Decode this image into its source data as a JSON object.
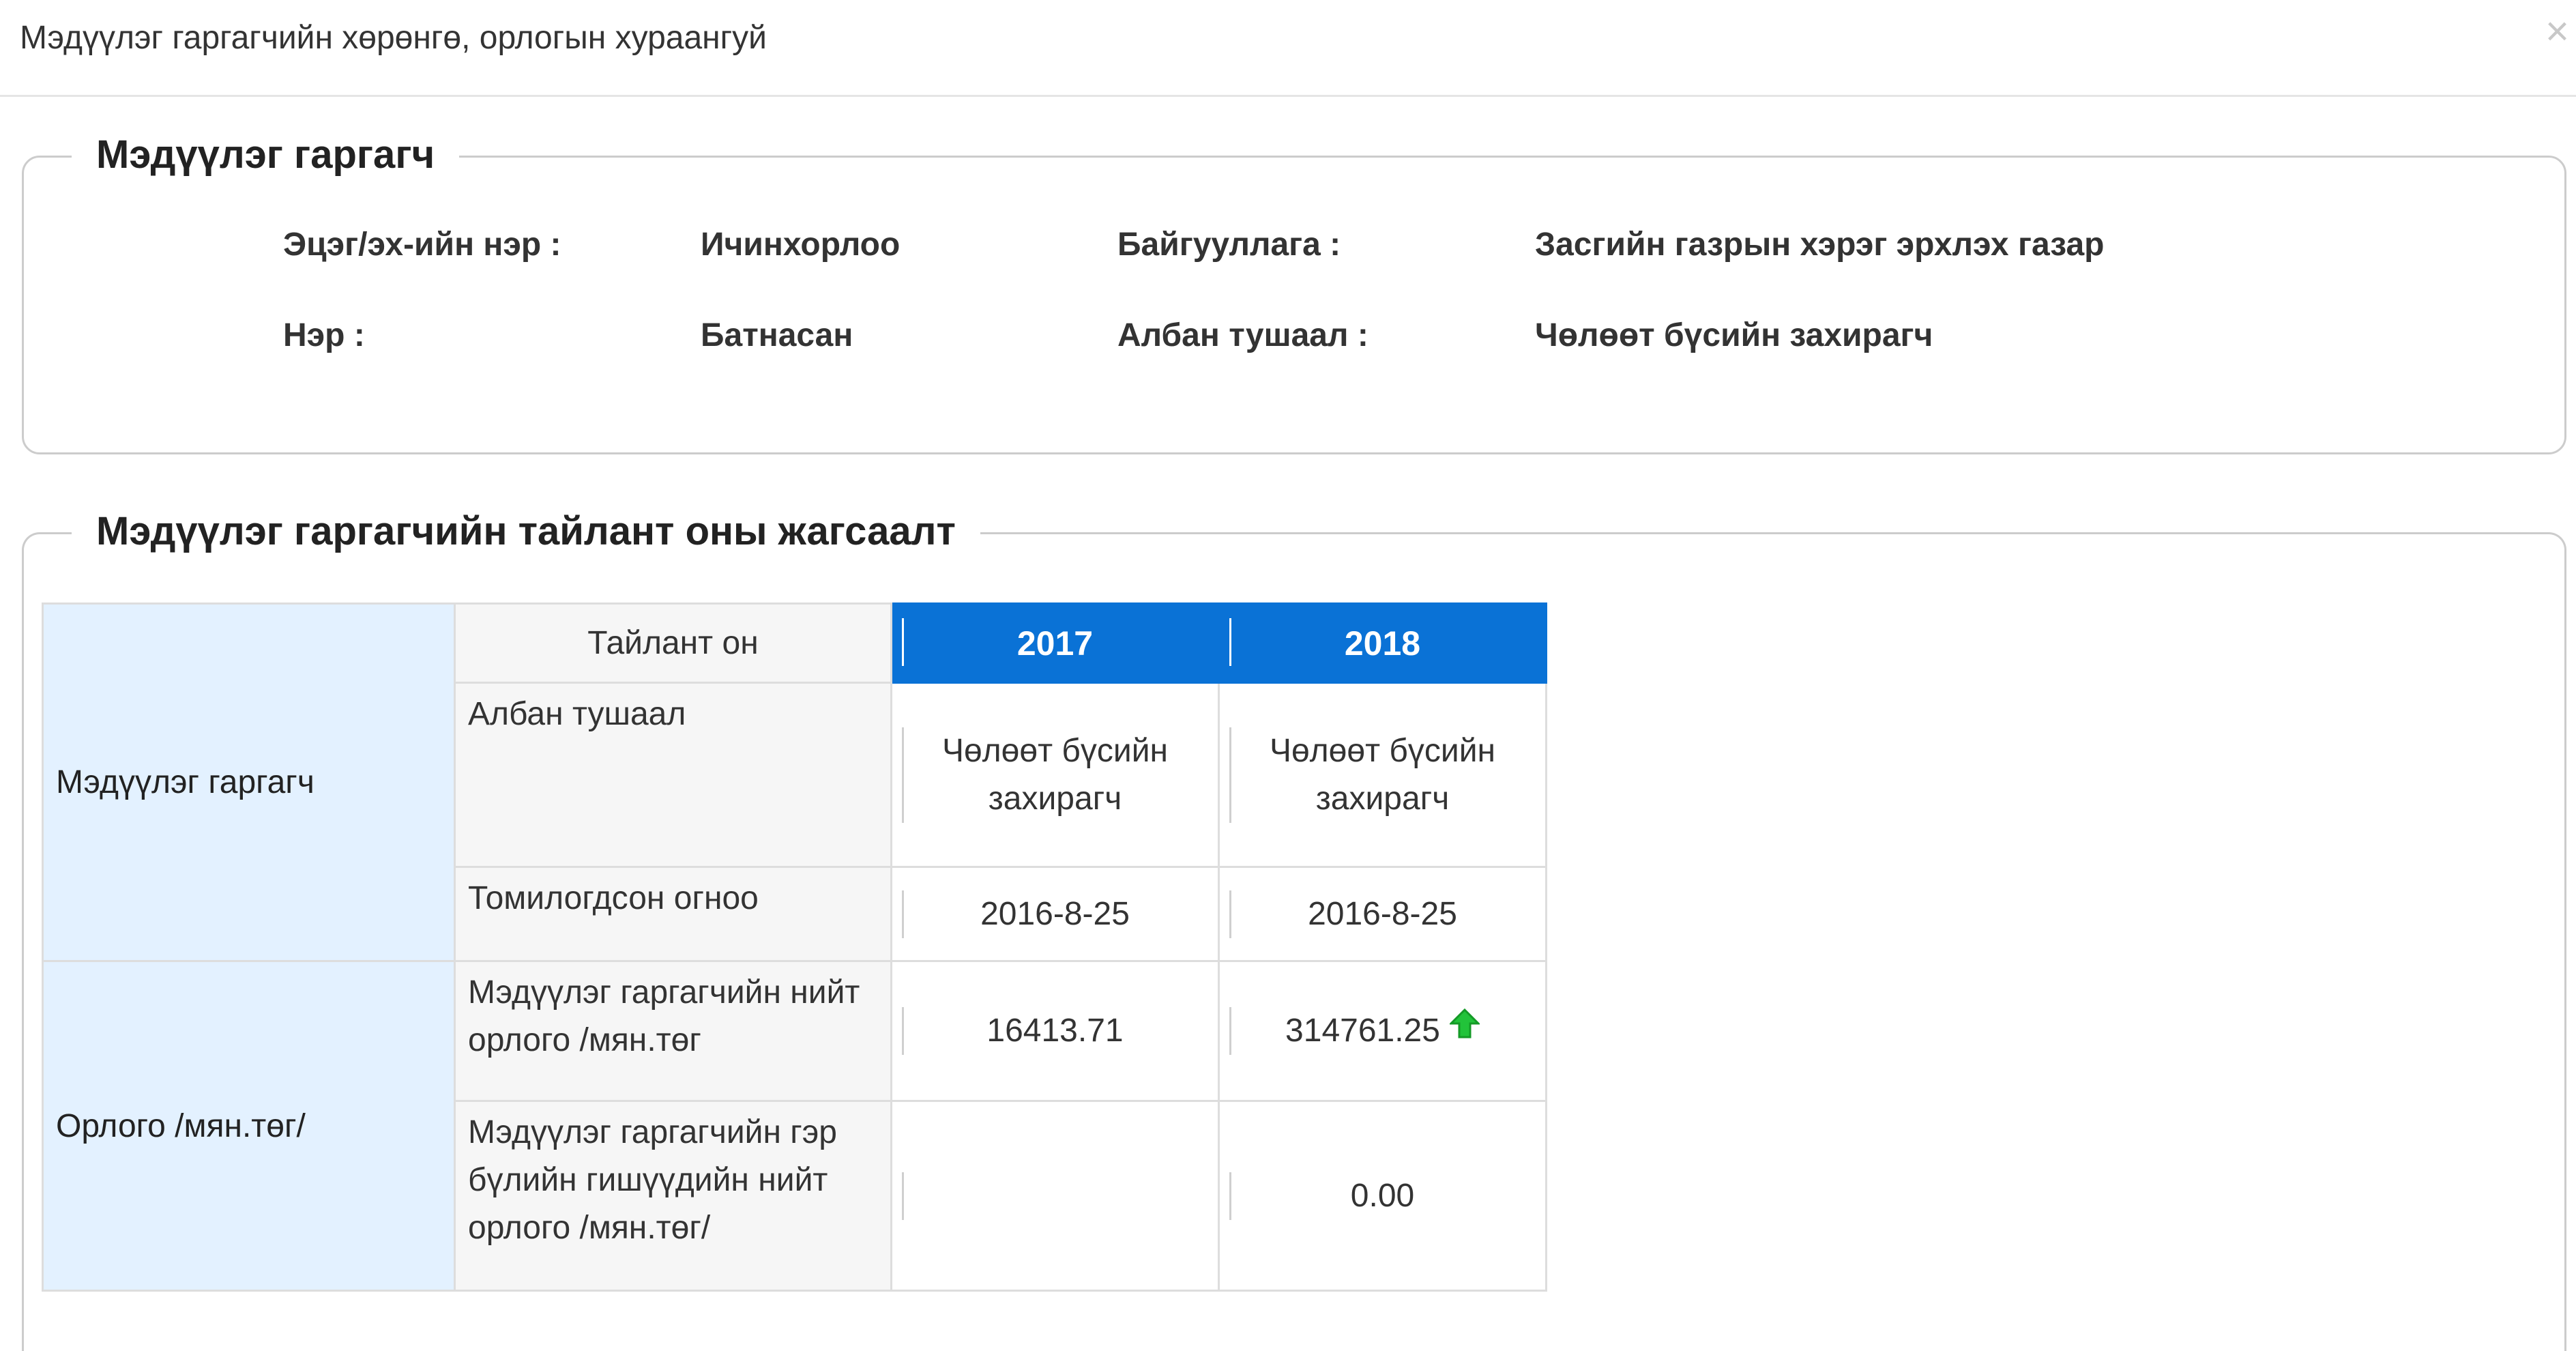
{
  "modal": {
    "title": "Мэдүүлэг гаргагчийн хөрөнгө, орлогын хураангуй",
    "close_label": "×"
  },
  "declarant": {
    "legend": "Мэдүүлэг гаргагч",
    "fields": [
      {
        "label": "Эцэг/эх-ийн нэр :",
        "value": "Ичинхорлоо"
      },
      {
        "label": "Нэр :",
        "value": "Батнасан"
      },
      {
        "label": "Байгууллага :",
        "value": "Засгийн газрын хэрэг эрхлэх газар"
      },
      {
        "label": "Албан тушаал :",
        "value": "Чөлөөт бүсийн захирагч"
      }
    ]
  },
  "summary": {
    "legend": "Мэдүүлэг гаргагчийн тайлант оны жагсаалт",
    "header_label": "Тайлант он",
    "years": [
      "2017",
      "2018"
    ],
    "groups": [
      {
        "name": "Мэдүүлэг гаргагч",
        "rows": [
          {
            "label": "Албан тушаал",
            "values": [
              "Чөлөөт бүсийн захирагч",
              "Чөлөөт бүсийн захирагч"
            ]
          },
          {
            "label": "Томилогдсон огноо",
            "values": [
              "2016-8-25",
              "2016-8-25"
            ]
          }
        ]
      },
      {
        "name": "Орлого /мян.төг/",
        "rows": [
          {
            "label": "Мэдүүлэг гаргагчийн нийт орлого /мян.төг",
            "values": [
              "16413.71",
              "314761.25"
            ],
            "trend": "up-arrow-icon"
          },
          {
            "label": "Мэдүүлэг гаргагчийн гэр бүлийн гишүүдийн нийт орлого /мян.төг/",
            "values": [
              "",
              "0.00"
            ]
          }
        ]
      }
    ]
  },
  "colors": {
    "header_blue": "#0a72d6",
    "group_bg": "#e3f1ff",
    "trend_up": "#22c33a"
  }
}
